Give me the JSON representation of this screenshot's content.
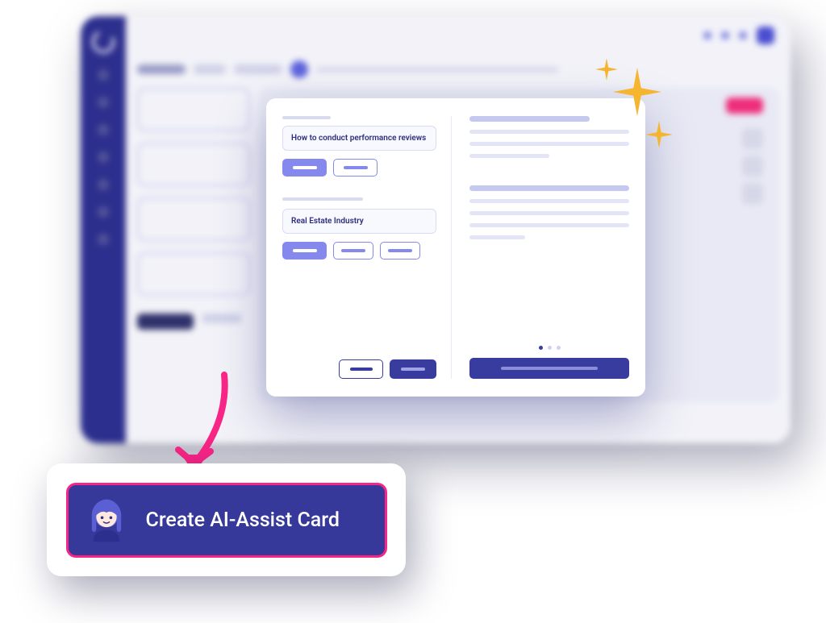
{
  "modal": {
    "input_topic": "How to conduct performance reviews",
    "input_context": "Real Estate Industry"
  },
  "callout": {
    "button_label": "Create AI-Assist Card"
  },
  "icons": {
    "sparkle": "sparkle-icon",
    "avatar": "ai-avatar-icon",
    "arrow": "pointer-arrow"
  }
}
